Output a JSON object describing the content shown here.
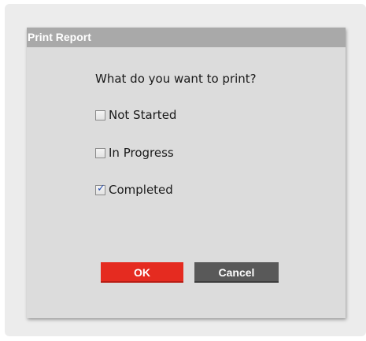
{
  "dialog": {
    "title": "Print Report",
    "prompt": "What do you want to print?",
    "options": [
      {
        "label": "Not Started",
        "checked": false
      },
      {
        "label": "In Progress",
        "checked": false
      },
      {
        "label": "Completed",
        "checked": true
      }
    ],
    "ok_label": "OK",
    "cancel_label": "Cancel"
  },
  "colors": {
    "ok_button": "#e52b20",
    "cancel_button": "#595959",
    "titlebar": "#a9a9a9",
    "dialog_background": "#dcdcdc"
  }
}
